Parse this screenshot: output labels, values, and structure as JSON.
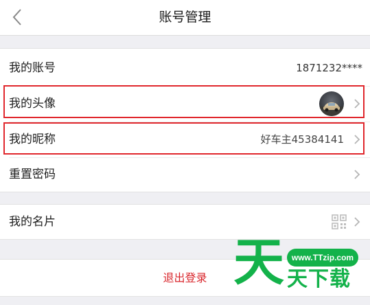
{
  "header": {
    "title": "账号管理",
    "back_icon": "chevron-left-icon"
  },
  "account": {
    "label": "我的账号",
    "value": "1871232****"
  },
  "avatar_row": {
    "label": "我的头像",
    "avatar_icon": "avatar-photo-icon"
  },
  "nickname": {
    "label": "我的昵称",
    "value": "好车主45384141"
  },
  "password": {
    "label": "重置密码"
  },
  "card": {
    "label": "我的名片",
    "qr_icon": "qr-code-icon"
  },
  "logout": {
    "label": "退出登录"
  },
  "watermark": {
    "url": "www.TTzip.com",
    "glyph": "天",
    "text": "天下载"
  },
  "colors": {
    "highlight": "#e0262c",
    "logout": "#d9252b",
    "watermark": "#13b24a",
    "background": "#efeff3"
  }
}
